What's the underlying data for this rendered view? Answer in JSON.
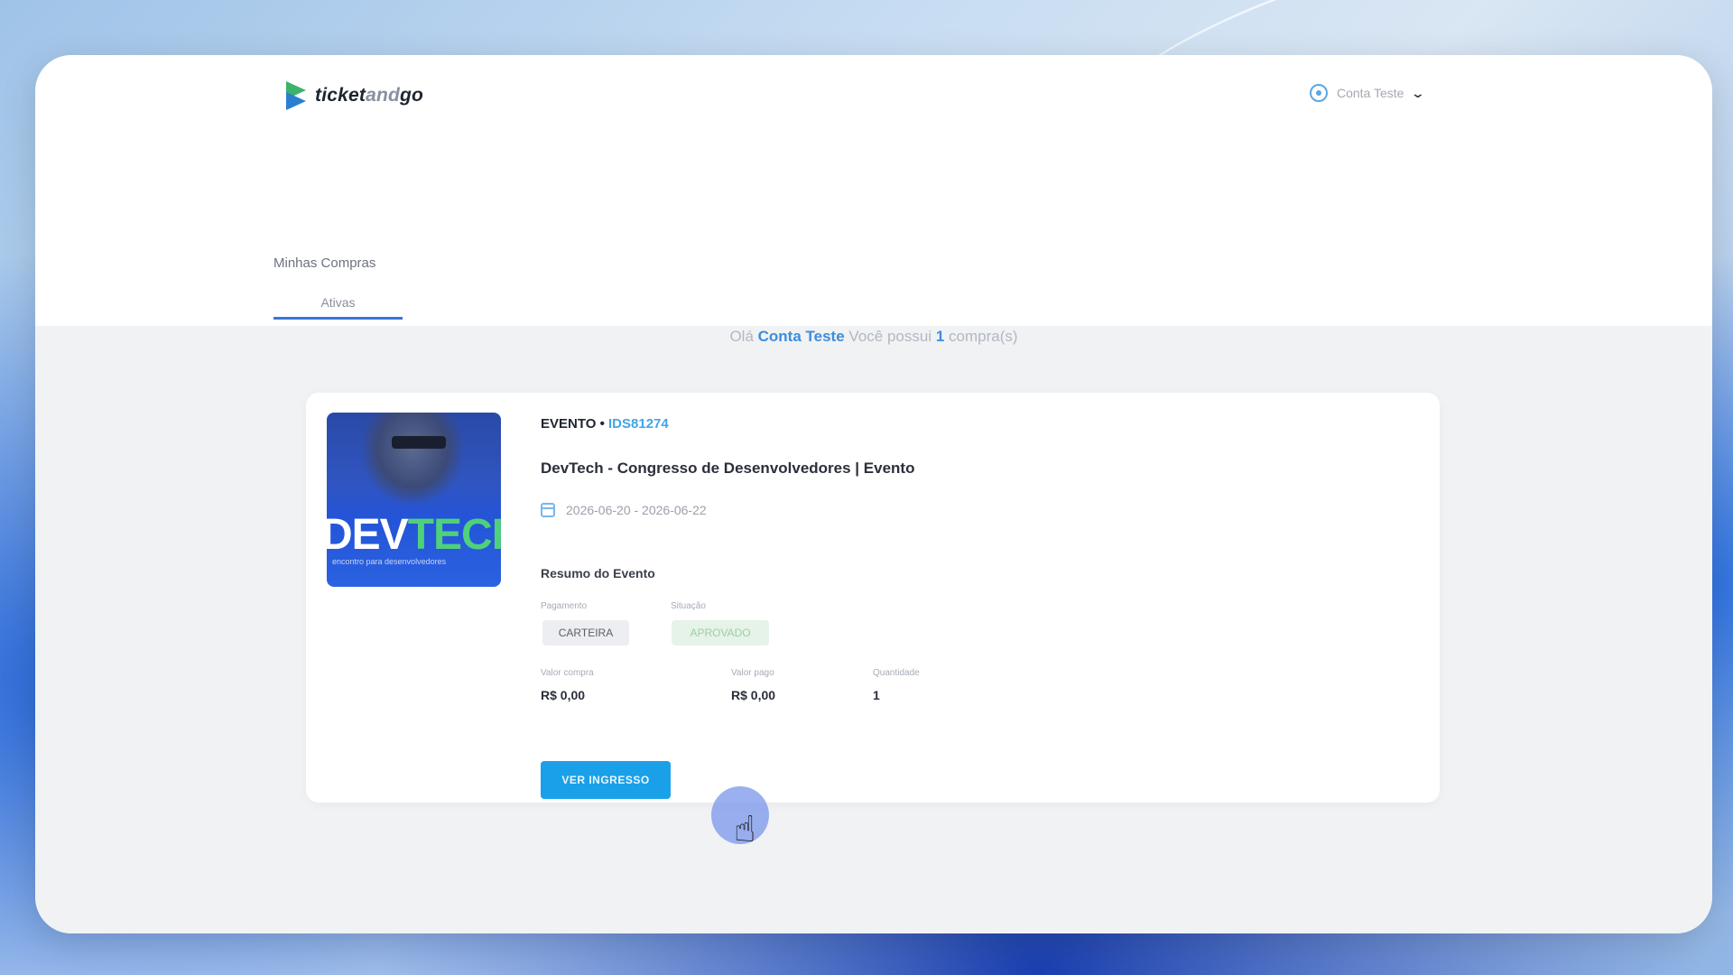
{
  "header": {
    "logo_text_main": "ticket",
    "logo_text_soft": "and",
    "logo_text_end": "go",
    "account_name": "Conta Teste"
  },
  "page": {
    "title": "Minhas Compras",
    "tabs": [
      {
        "label": "Ativas",
        "active": true
      }
    ]
  },
  "greeting": {
    "prefix": "Olá",
    "name": "Conta Teste",
    "middle": "Você possui",
    "count": "1",
    "suffix": "compra(s)"
  },
  "purchase": {
    "type_label": "EVENTO •",
    "code": "IDS81274",
    "event_name": "DevTech - Congresso de Desenvolvedores | Evento",
    "dates": "2026-06-20 - 2026-06-22",
    "thumb_text_white": "DEV",
    "thumb_text_green": "TECH",
    "thumb_subtitle": "encontro para desenvolvedores",
    "summary_title": "Resumo do Evento",
    "payment_label": "Pagamento",
    "payment_value": "CARTEIRA",
    "status_label": "Situação",
    "status_value": "APROVADO",
    "purchase_value_label": "Valor compra",
    "purchase_value": "R$ 0,00",
    "paid_value_label": "Valor pago",
    "paid_value": "R$ 0,00",
    "quantity_label": "Quantidade",
    "quantity": "1",
    "view_button_label": "VER INGRESSO"
  },
  "colors": {
    "accent": "#1aa0e8",
    "tab_underline": "#3a74d8",
    "status": "#9cd0a4"
  }
}
